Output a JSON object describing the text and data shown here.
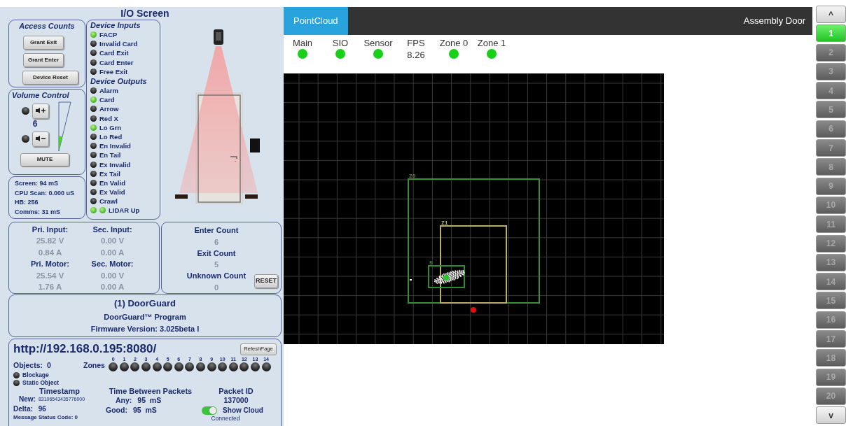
{
  "io_panel": {
    "title": "I/O Screen",
    "access_counts": {
      "title": "Access Counts",
      "buttons": [
        "Grant Exit",
        "Grant Enter",
        "Device Reset"
      ]
    },
    "volume_control": {
      "title": "Volume Control",
      "up_led_on": false,
      "down_led_on": false,
      "value": "6",
      "level": 0.3,
      "mute_button": "MUTE"
    },
    "stats": [
      "Screen: 94 mS",
      "CPU Scan: 0.000 uS",
      "HB: 256",
      "Comms: 31 mS"
    ],
    "device_inputs": {
      "title": "Device Inputs",
      "items": [
        {
          "label": "FACP",
          "on": true
        },
        {
          "label": "Invalid Card",
          "on": false
        },
        {
          "label": "Card Exit",
          "on": false
        },
        {
          "label": "Card Enter",
          "on": false
        },
        {
          "label": "Free Exit",
          "on": false
        }
      ]
    },
    "device_outputs": {
      "title": "Device Outputs",
      "items": [
        {
          "label": "Alarm",
          "kind": "single",
          "on": false
        },
        {
          "label": "Card",
          "kind": "single",
          "on": true
        },
        {
          "label": "Arrow",
          "kind": "single",
          "on": false
        },
        {
          "label": "Red X",
          "kind": "single",
          "on": false
        },
        {
          "label": "Lo Grn",
          "kind": "single",
          "on": true
        },
        {
          "label": "Lo Red",
          "kind": "single",
          "on": false
        },
        {
          "label": "En Invalid",
          "kind": "single",
          "on": false
        },
        {
          "label": "En Tail",
          "kind": "single",
          "on": false
        },
        {
          "label": "Ex Invalid",
          "kind": "single",
          "on": false
        },
        {
          "label": "Ex Tail",
          "kind": "single",
          "on": false
        },
        {
          "label": "En Valid",
          "kind": "single",
          "on": false
        },
        {
          "label": "Ex Valid",
          "kind": "single",
          "on": false
        },
        {
          "label": "Crawl",
          "kind": "single",
          "on": false
        },
        {
          "label": "LIDAR Up",
          "kind": "double",
          "on": true
        }
      ]
    },
    "power": [
      {
        "kind": "label",
        "cells": [
          "Pri. Input:",
          "Sec. Input:"
        ]
      },
      {
        "kind": "value",
        "cells": [
          "25.82 V",
          "0.00 V"
        ]
      },
      {
        "kind": "value",
        "cells": [
          "0.84 A",
          "0.00 A"
        ]
      },
      {
        "kind": "label",
        "cells": [
          "Pri. Motor:",
          "Sec. Motor:"
        ]
      },
      {
        "kind": "value",
        "cells": [
          "25.54 V",
          "0.00 V"
        ]
      },
      {
        "kind": "value",
        "cells": [
          "1.76 A",
          "0.00 A"
        ]
      }
    ],
    "counts": [
      {
        "label": "Enter Count",
        "value": "6"
      },
      {
        "label": "Exit Count",
        "value": "5"
      },
      {
        "label": "Unknown Count",
        "value": "0"
      }
    ],
    "reset_button": "RESET",
    "device_info": {
      "name": "(1) DoorGuard",
      "program": "DoorGuard™ Program",
      "firmware": "Firmware Version: 3.025beta I"
    },
    "connection": {
      "url": "http://192.168.0.195:8080/",
      "refresh_button": "RefeshPage",
      "objects_label": "Objects:",
      "objects_value": "0",
      "zones_label": "Zones",
      "zones": [
        {
          "number": "0",
          "on": false
        },
        {
          "number": "1",
          "on": false
        },
        {
          "number": "2",
          "on": false
        },
        {
          "number": "3",
          "on": false
        },
        {
          "number": "4",
          "on": false
        },
        {
          "number": "5",
          "on": false
        },
        {
          "number": "6",
          "on": false
        },
        {
          "number": "7",
          "on": false
        },
        {
          "number": "8",
          "on": false
        },
        {
          "number": "9",
          "on": false
        },
        {
          "number": "10",
          "on": false
        },
        {
          "number": "11",
          "on": false
        },
        {
          "number": "12",
          "on": false
        },
        {
          "number": "13",
          "on": false
        },
        {
          "number": "14",
          "on": false
        }
      ],
      "flags": [
        {
          "label": "Blockage",
          "on": false
        },
        {
          "label": "Static Object",
          "on": false
        }
      ],
      "timestamp": {
        "title": "Timestamp",
        "new_label": "New:",
        "new_value": "83106543435776000",
        "delta_label": "Delta:",
        "delta_value": "96"
      },
      "time_between_packets": {
        "title": "Time Between Packets",
        "any_label": "Any:",
        "any_value": "95  mS",
        "good_label": "Good:",
        "good_value": "95  mS"
      },
      "packet_id": {
        "title": "Packet ID",
        "value": "137000"
      },
      "show_cloud": {
        "label": "Show Cloud",
        "on": true
      },
      "connection_status": "Connected",
      "message_status": "Message Status Code:  0"
    }
  },
  "pointcloud": {
    "tab": "PointCloud",
    "device_name": "Assembly Door",
    "status": [
      {
        "label": "Main",
        "kind": "led",
        "on": true
      },
      {
        "label": "SIO",
        "kind": "led",
        "on": true
      },
      {
        "label": "Sensor",
        "kind": "led",
        "on": true
      },
      {
        "label": "FPS",
        "kind": "value",
        "value": "8.26"
      },
      {
        "label": "Zone 0",
        "kind": "led",
        "on": true
      },
      {
        "label": "Zone 1",
        "kind": "led",
        "on": true
      }
    ],
    "zones": [
      {
        "label": "Z0",
        "color": "#3c8c3c"
      },
      {
        "label": "Z1",
        "color": "#b9ad6e"
      },
      {
        "label": "5",
        "color": "#2e8b2e"
      }
    ]
  },
  "sidebar": {
    "up_button": "^",
    "down_button": "v",
    "items": [
      {
        "label": "1",
        "selected": true
      },
      {
        "label": "2",
        "selected": false
      },
      {
        "label": "3",
        "selected": false
      },
      {
        "label": "4",
        "selected": false
      },
      {
        "label": "5",
        "selected": false
      },
      {
        "label": "6",
        "selected": false
      },
      {
        "label": "7",
        "selected": false
      },
      {
        "label": "8",
        "selected": false
      },
      {
        "label": "9",
        "selected": false
      },
      {
        "label": "10",
        "selected": false
      },
      {
        "label": "11",
        "selected": false
      },
      {
        "label": "12",
        "selected": false
      },
      {
        "label": "13",
        "selected": false
      },
      {
        "label": "14",
        "selected": false
      },
      {
        "label": "15",
        "selected": false
      },
      {
        "label": "16",
        "selected": false
      },
      {
        "label": "17",
        "selected": false
      },
      {
        "label": "18",
        "selected": false
      },
      {
        "label": "19",
        "selected": false
      },
      {
        "label": "20",
        "selected": false
      }
    ]
  }
}
